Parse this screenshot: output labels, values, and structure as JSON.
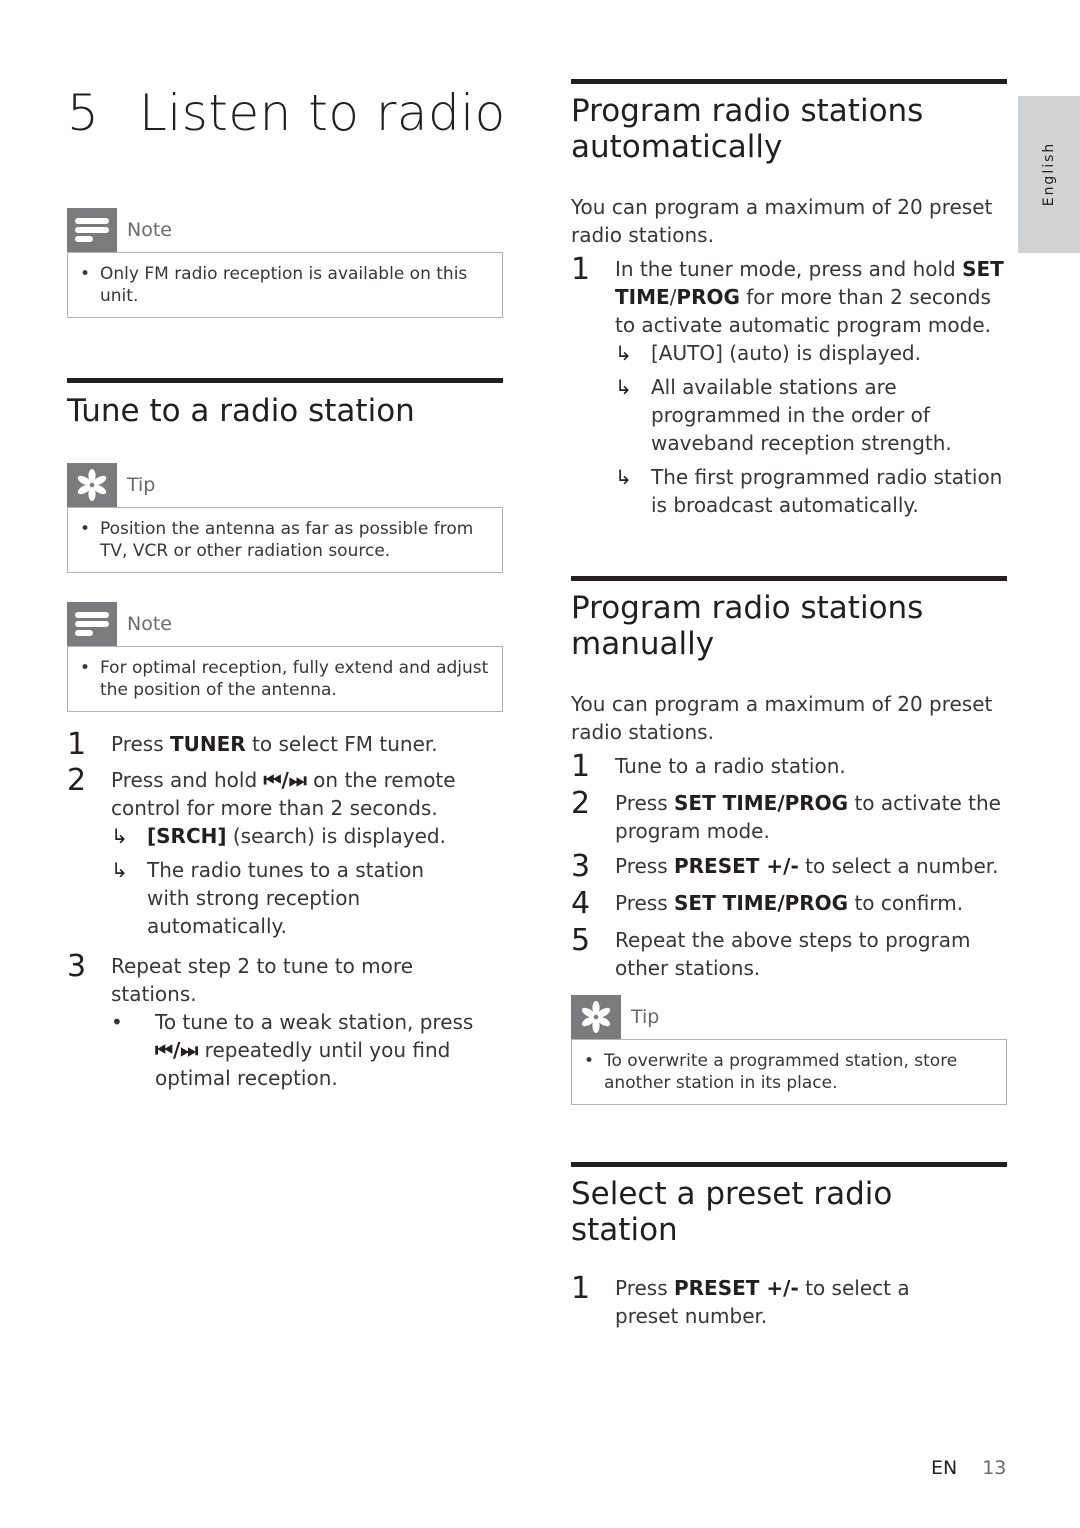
{
  "chapter": {
    "number": "5",
    "title": "Listen to radio"
  },
  "language_tab": "English",
  "left": {
    "note1": {
      "label": "Note",
      "icon": "note-icon",
      "items": [
        "Only FM radio reception is available on this unit."
      ]
    },
    "section_title": "Tune to a radio station",
    "tip1": {
      "label": "Tip",
      "icon": "tip-icon",
      "items": [
        "Position the antenna as far as possible from TV, VCR or other radiation source."
      ]
    },
    "note2": {
      "label": "Note",
      "icon": "note-icon",
      "items": [
        "For optimal reception, fully extend and adjust the position of the antenna."
      ]
    },
    "steps": [
      {
        "num": "1",
        "pre": "Press ",
        "bold": "TUNER",
        "post": " to select FM tuner."
      },
      {
        "num": "2",
        "pre": "Press and hold ",
        "bold": "⏮/⏭",
        "post": " on the remote control for more than 2 seconds.",
        "results": [
          {
            "bold": "[SRCH]",
            "text": " (search) is displayed."
          },
          {
            "bold": "",
            "text": "The radio tunes to a station with strong reception automatically."
          }
        ]
      },
      {
        "num": "3",
        "pre": "Repeat step 2 to tune to more stations.",
        "bold": "",
        "post": "",
        "bullets": [
          {
            "pre": "To tune to a weak station, press ",
            "bold": "⏮/⏭",
            "post": " repeatedly until you find optimal reception."
          }
        ]
      }
    ]
  },
  "right": {
    "auto": {
      "title": "Program radio stations automatically",
      "intro": "You can program a maximum of 20 preset radio stations.",
      "steps": [
        {
          "num": "1",
          "pre": "In the tuner mode, press and hold ",
          "bold": "SET TIME",
          "mid": "/",
          "bold2": "PROG",
          "post": " for more than 2 seconds to activate automatic program mode.",
          "results": [
            "[AUTO] (auto) is displayed.",
            "All available stations are programmed in the order of waveband reception strength.",
            "The first programmed radio station is broadcast automatically."
          ]
        }
      ]
    },
    "manual": {
      "title": "Program radio stations manually",
      "intro": "You can program a maximum of 20 preset radio stations.",
      "steps": [
        {
          "num": "1",
          "pre": "Tune to a radio station.",
          "bold": "",
          "post": ""
        },
        {
          "num": "2",
          "pre": "Press ",
          "bold": "SET TIME/PROG",
          "post": " to activate the program mode."
        },
        {
          "num": "3",
          "pre": "Press ",
          "bold": "PRESET +/-",
          "post": " to select a number."
        },
        {
          "num": "4",
          "pre": "Press ",
          "bold": "SET TIME/PROG",
          "post": " to confirm."
        },
        {
          "num": "5",
          "pre": "Repeat the above steps to program other stations.",
          "bold": "",
          "post": ""
        }
      ],
      "tip": {
        "label": "Tip",
        "icon": "tip-icon",
        "items": [
          "To overwrite a programmed station, store another station in its place."
        ]
      }
    },
    "preset": {
      "title": "Select a preset radio station",
      "steps": [
        {
          "num": "1",
          "pre": "Press ",
          "bold": "PRESET +/-",
          "post": " to select a preset number."
        }
      ]
    }
  },
  "footer": {
    "lang": "EN",
    "page": "13"
  }
}
